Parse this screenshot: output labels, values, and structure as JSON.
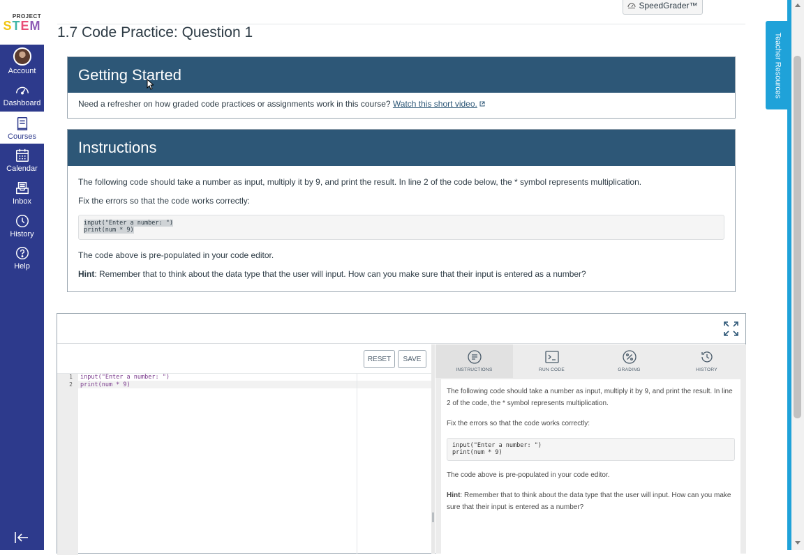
{
  "logo": {
    "small": "PROJECT",
    "big": [
      "S",
      "T",
      "E",
      "M"
    ]
  },
  "nav": {
    "items": [
      {
        "label": "Account",
        "icon": "avatar-icon"
      },
      {
        "label": "Dashboard",
        "icon": "dashboard-icon"
      },
      {
        "label": "Courses",
        "icon": "courses-icon"
      },
      {
        "label": "Calendar",
        "icon": "calendar-icon"
      },
      {
        "label": "Inbox",
        "icon": "inbox-icon"
      },
      {
        "label": "History",
        "icon": "history-icon"
      },
      {
        "label": "Help",
        "icon": "help-icon"
      }
    ],
    "active": "Courses",
    "collapse_icon": "collapse-nav-icon"
  },
  "header": {
    "speedgrader_label": "SpeedGrader™",
    "title": "1.7 Code Practice: Question 1"
  },
  "getting_started": {
    "heading": "Getting Started",
    "text": "Need a refresher on how graded code practices or assignments work in this course?",
    "link_label": "Watch this short video."
  },
  "instructions": {
    "heading": "Instructions",
    "p1": "The following code should take a number as input, multiply it by 9, and print the result. In line 2 of the code below, the * symbol represents multiplication.",
    "p2": "Fix the errors so that the code works correctly:",
    "code_line1": "input(\"Enter a number: \")",
    "code_line2": "print(num * 9)",
    "p3": "The code above is pre-populated in your code editor.",
    "hint_label": "Hint",
    "hint_text": ": Remember that to think about the data type that the user will input. How can you make sure that their input is entered as a number?"
  },
  "ide": {
    "reset_label": "RESET",
    "save_label": "SAVE",
    "lines": [
      {
        "num": "1",
        "code": "input(\"Enter a number: \")"
      },
      {
        "num": "2",
        "code": "print(num * 9)"
      }
    ],
    "tabs": [
      {
        "label": "INSTRUCTIONS",
        "icon": "instructions-icon"
      },
      {
        "label": "RUN CODE",
        "icon": "terminal-icon"
      },
      {
        "label": "GRADING",
        "icon": "grading-icon"
      },
      {
        "label": "HISTORY",
        "icon": "history-icon"
      }
    ],
    "active_tab": "INSTRUCTIONS",
    "side": {
      "p1": "The following code should take a number as input, multiply it by 9, and print the result. In line 2 of the code, the * symbol represents multiplication.",
      "p2": "Fix the errors so that the code works correctly:",
      "code": "input(\"Enter a number: \")\nprint(num * 9)",
      "p3": "The code above is pre-populated in your code editor.",
      "hint_label": "Hint",
      "hint_text": ": Remember that to think about the data type that the user will input. How can you make sure that their input is entered as a number?"
    }
  },
  "teacher_resources_label": "Teacher Resources",
  "colors": {
    "nav": "#2d3a8c",
    "panel_header": "#2d5777",
    "accent": "#1fa2d9"
  }
}
